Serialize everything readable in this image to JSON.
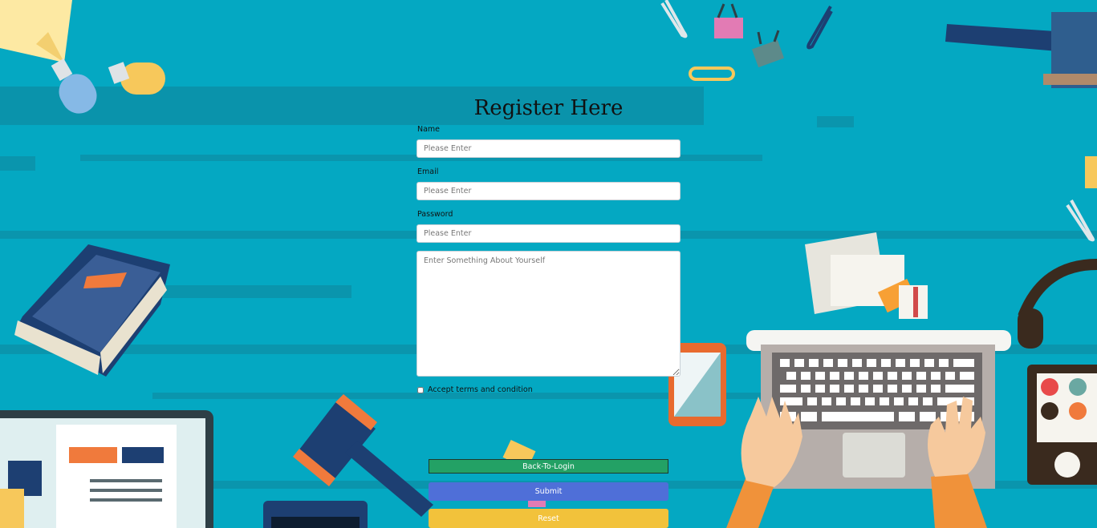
{
  "form": {
    "title": "Register Here",
    "name_label": "Name",
    "name_placeholder": "Please Enter",
    "email_label": "Email",
    "email_placeholder": "Please Enter",
    "password_label": "Password",
    "password_placeholder": "Please Enter",
    "about_placeholder": "Enter Something About Yourself",
    "terms_label": "Accept terms and condition"
  },
  "buttons": {
    "back_to_login": "Back-To-Login",
    "submit": "Submit",
    "reset": "Reset"
  },
  "colors": {
    "background": "#04a8c2",
    "back_to_login": "#23a165",
    "submit": "#4f6fd8",
    "reset": "#f2c23b"
  }
}
